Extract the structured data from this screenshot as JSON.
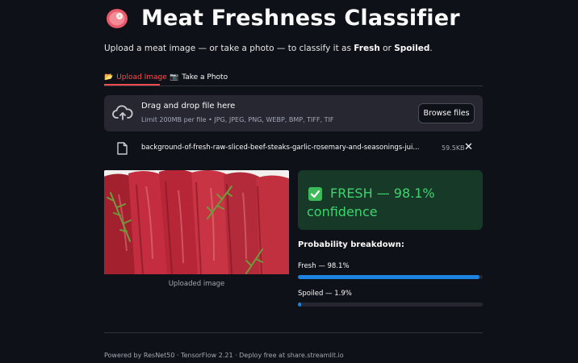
{
  "header": {
    "icon": "meat-icon",
    "title": "Meat Freshness Classifier"
  },
  "subtitle": {
    "prefix": "Upload a meat image — or take a photo — to classify it as ",
    "fresh": "Fresh",
    "middle": " or ",
    "spoiled": "Spoiled",
    "suffix": "."
  },
  "tabs": [
    {
      "label": "Upload Image",
      "icon": "folder-icon",
      "active": true
    },
    {
      "label": "Take a Photo",
      "icon": "camera-icon",
      "active": false
    }
  ],
  "uploader": {
    "title": "Drag and drop file here",
    "limits": "Limit 200MB per file • JPG, JPEG, PNG, WEBP, BMP, TIFF, TIF",
    "browse_label": "Browse files"
  },
  "file": {
    "name": "background-of-fresh-raw-sliced-beef-steaks-garlic-rosemary-and-seasonings-jui...",
    "size": "59.5KB"
  },
  "image": {
    "caption": "Uploaded image"
  },
  "result": {
    "line1": "FRESH — 98.1%",
    "line2": "confidence",
    "color": "#3dd56d",
    "background": "#173928"
  },
  "breakdown": {
    "title": "Probability breakdown:",
    "items": [
      {
        "label": "Fresh — 98.1%",
        "value": 0.981
      },
      {
        "label": "Spoiled — 1.9%",
        "value": 0.019
      }
    ],
    "bar_color": "#1c83e1"
  },
  "footer": {
    "text": "Powered by ResNet50 · TensorFlow 2.21 · Deploy free at share.streamlit.io"
  },
  "colors": {
    "background": "#0e1117",
    "accent": "#ff4b4b",
    "panel": "#262730"
  }
}
